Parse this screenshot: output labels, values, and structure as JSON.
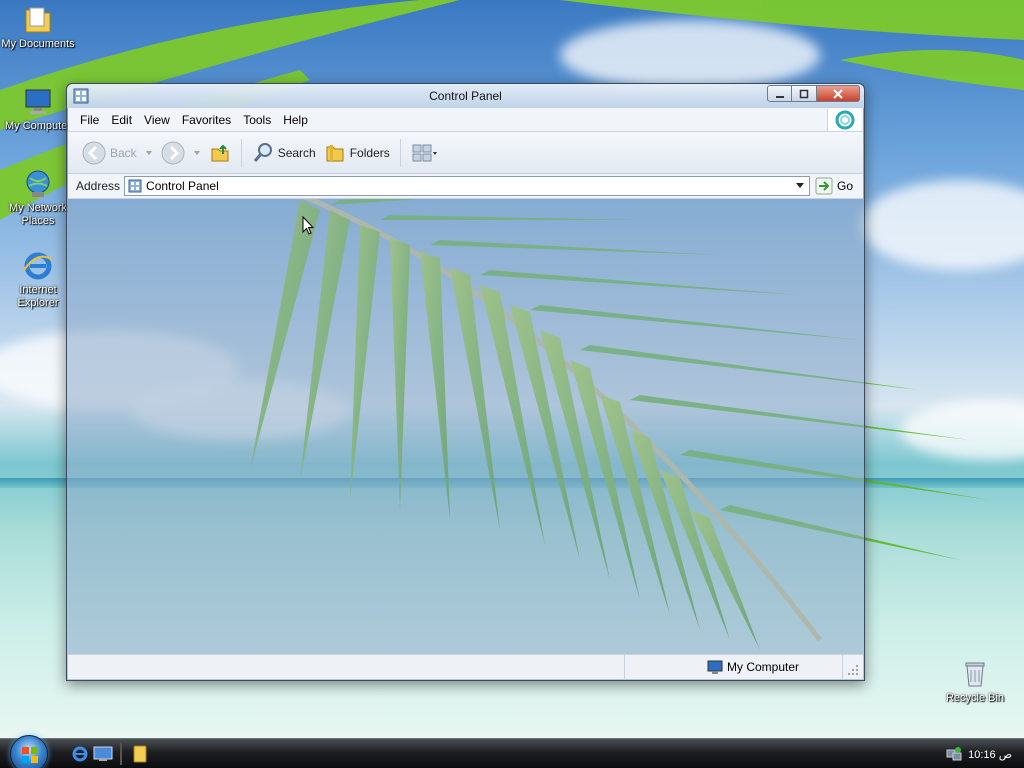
{
  "desktop": {
    "icons": [
      {
        "label": "My Documents"
      },
      {
        "label": "My Computer"
      },
      {
        "label": "My Network Places"
      },
      {
        "label": "Internet Explorer"
      }
    ],
    "recycle_bin_label": "Recycle Bin"
  },
  "window": {
    "title": "Control Panel",
    "menu": [
      "File",
      "Edit",
      "View",
      "Favorites",
      "Tools",
      "Help"
    ],
    "toolbar": {
      "back_label": "Back",
      "search_label": "Search",
      "folders_label": "Folders"
    },
    "address": {
      "label": "Address",
      "value": "Control Panel",
      "go_label": "Go"
    },
    "status": {
      "zone_label": "My Computer"
    }
  },
  "taskbar": {
    "clock": "10:16 ص"
  },
  "colors": {
    "titlebar": "#dbe7f3",
    "taskbar": "#1d1f22",
    "accent_blue": "#3a86d1"
  }
}
